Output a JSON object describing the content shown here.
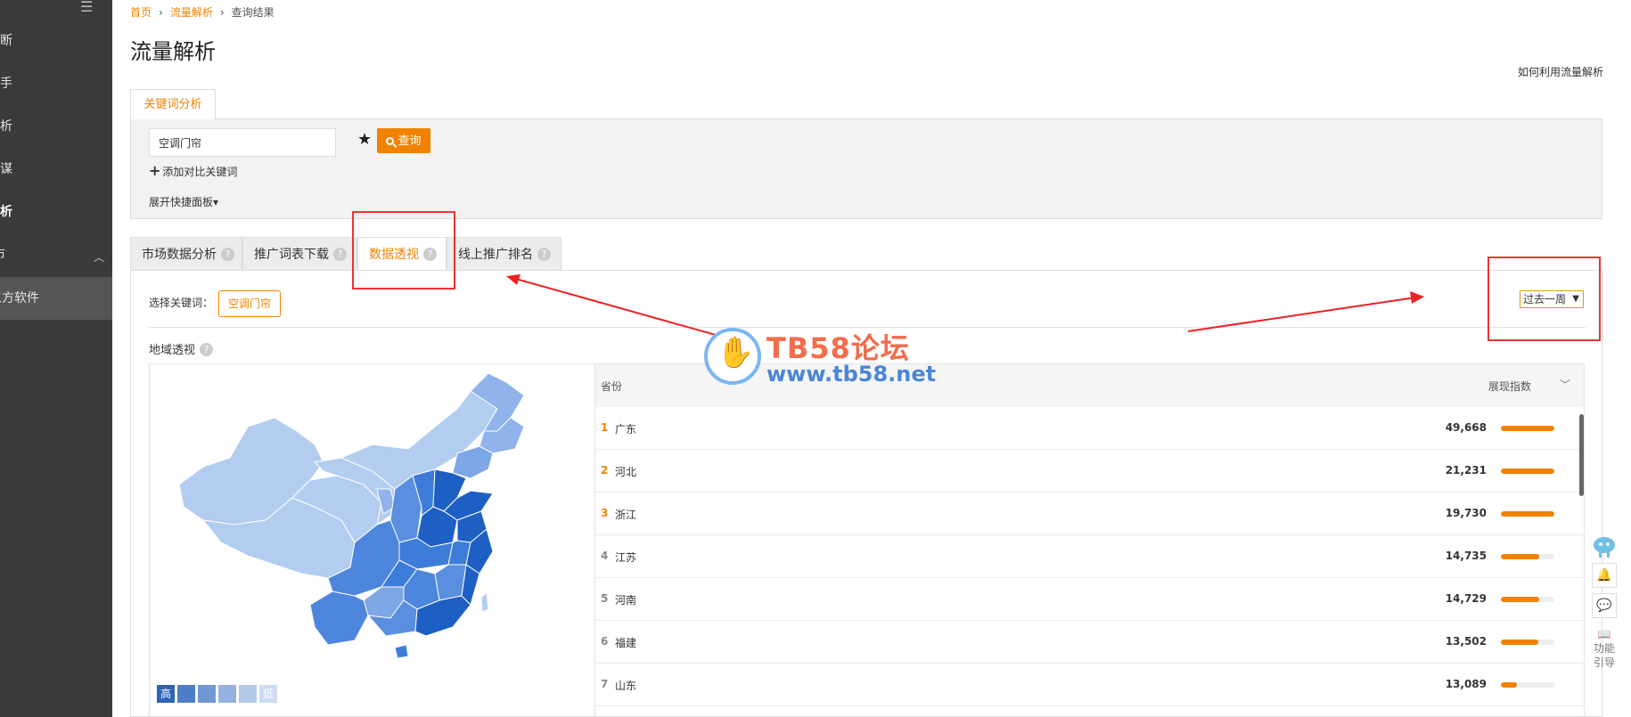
{
  "sidebar": {
    "collapse_icon": "menu-collapse-icon",
    "items": [
      {
        "label": "诊断"
      },
      {
        "label": "助手"
      },
      {
        "label": "分析"
      },
      {
        "label": "参谋"
      },
      {
        "label": "解析"
      },
      {
        "label": "市"
      },
      {
        "label": "三方软件"
      }
    ]
  },
  "breadcrumb": {
    "home": "首页",
    "section": "流量解析",
    "current": "查询结果"
  },
  "page": {
    "title": "流量解析",
    "help_link": "如何利用流量解析"
  },
  "keyword_tab": {
    "label": "关键词分析"
  },
  "search": {
    "input_value": "空调门帘",
    "query_label": "查询",
    "add_compare": "添加对比关键词",
    "expand_panel": "展开快捷面板"
  },
  "tabs": [
    {
      "label": "市场数据分析"
    },
    {
      "label": "推广词表下载"
    },
    {
      "label": "数据透视"
    },
    {
      "label": "线上推广排名"
    }
  ],
  "content": {
    "select_keyword_label": "选择关键词：",
    "keyword_chip": "空调门帘",
    "period": "过去一周",
    "geo_title": "地域透视"
  },
  "legend": {
    "high": "高",
    "low": "低",
    "colors": [
      "#2f63b6",
      "#4f7ec8",
      "#7097d3",
      "#94b1df",
      "#b3c9ea",
      "#cddcf2"
    ]
  },
  "table": {
    "col_province": "省份",
    "col_index": "展现指数",
    "rows": [
      {
        "rank": "1",
        "province": "广东",
        "value": "49,668",
        "pct": 1.0
      },
      {
        "rank": "2",
        "province": "河北",
        "value": "21,231",
        "pct": 1.0
      },
      {
        "rank": "3",
        "province": "浙江",
        "value": "19,730",
        "pct": 1.0
      },
      {
        "rank": "4",
        "province": "江苏",
        "value": "14,735",
        "pct": 0.72
      },
      {
        "rank": "5",
        "province": "河南",
        "value": "14,729",
        "pct": 0.72
      },
      {
        "rank": "6",
        "province": "福建",
        "value": "13,502",
        "pct": 0.7
      },
      {
        "rank": "7",
        "province": "山东",
        "value": "13,089",
        "pct": 0.3
      }
    ]
  },
  "watermark": {
    "line1": "TB58论坛",
    "line2": "www.tb58.net"
  },
  "rail": {
    "guide_line1": "功能",
    "guide_line2": "引导"
  }
}
